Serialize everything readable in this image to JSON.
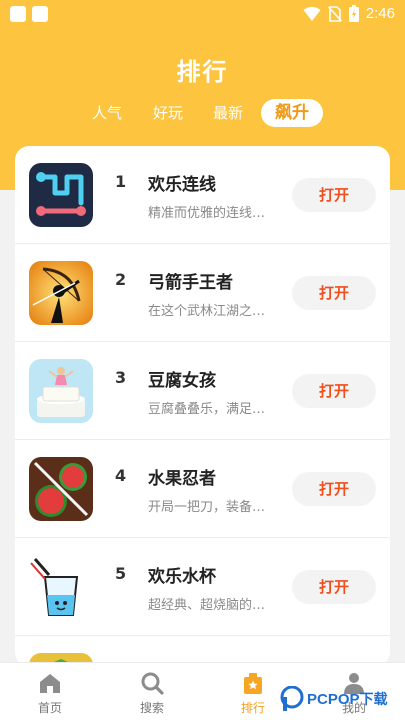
{
  "status_bar": {
    "time": "2:46"
  },
  "header": {
    "title": "排行"
  },
  "tabs": [
    {
      "label": "人气"
    },
    {
      "label": "好玩"
    },
    {
      "label": "最新"
    },
    {
      "label": "飙升",
      "active": true
    }
  ],
  "list": [
    {
      "rank": "1",
      "name": "欢乐连线",
      "desc": "精准而优雅的连线…",
      "action": "打开",
      "icon": "line-puzzle-icon"
    },
    {
      "rank": "2",
      "name": "弓箭手王者",
      "desc": "在这个武林江湖之…",
      "action": "打开",
      "icon": "archer-icon"
    },
    {
      "rank": "3",
      "name": "豆腐女孩",
      "desc": "豆腐叠叠乐，满足…",
      "action": "打开",
      "icon": "tofu-girl-icon"
    },
    {
      "rank": "4",
      "name": "水果忍者",
      "desc": "开局一把刀，装备…",
      "action": "打开",
      "icon": "watermelon-icon"
    },
    {
      "rank": "5",
      "name": "欢乐水杯",
      "desc": "超经典、超烧脑的…",
      "action": "打开",
      "icon": "water-cup-icon"
    }
  ],
  "bottom_nav": [
    {
      "label": "首页",
      "icon": "home-icon"
    },
    {
      "label": "搜索",
      "icon": "search-icon"
    },
    {
      "label": "排行",
      "icon": "ranking-icon",
      "active": true
    },
    {
      "label": "我的",
      "icon": "user-icon"
    }
  ],
  "watermark": {
    "brand": "PCPOP",
    "suffix": "下载"
  },
  "colors": {
    "accent": "#fdc53f",
    "button_text": "#f0501e",
    "active_tab": "#f09a1a"
  }
}
